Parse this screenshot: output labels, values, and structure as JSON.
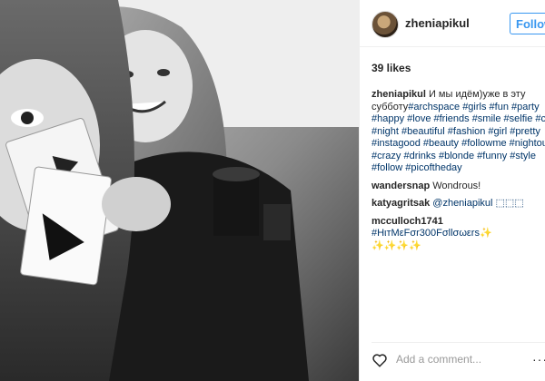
{
  "post": {
    "username": "zheniapikul",
    "follow_label": "Follow",
    "likes": "39 likes",
    "caption_user": "zheniapikul",
    "caption_lines": [
      "И мы идём)уже в эту",
      "субботу",
      "#happy #love #friends #smile #selfie #cu",
      "#night #beautiful #fashion #girl #pretty",
      "#instagood #beauty #followme #nightout",
      "#crazy #drinks #blonde #funny #style",
      "#follow #picoftheday"
    ],
    "caption_line2_tags": "#archspace #girls #fun #party",
    "comments": [
      {
        "user": "wandersnap",
        "text": "Wondrous!"
      },
      {
        "user": "katyagritsak",
        "text": "@zheniapikul ⬚⬚⬚"
      },
      {
        "user": "mcculloch1741",
        "text": "#HιтMεFσr300Fσllσωεrѕ✨",
        "extra": "✨✨✨✨"
      }
    ],
    "add_comment_placeholder": "Add a comment...",
    "more_label": "···"
  },
  "icons": {
    "heart": "heart-icon",
    "more": "more-options-icon"
  },
  "colors": {
    "accent": "#3897f0",
    "hashtag": "#003569"
  }
}
